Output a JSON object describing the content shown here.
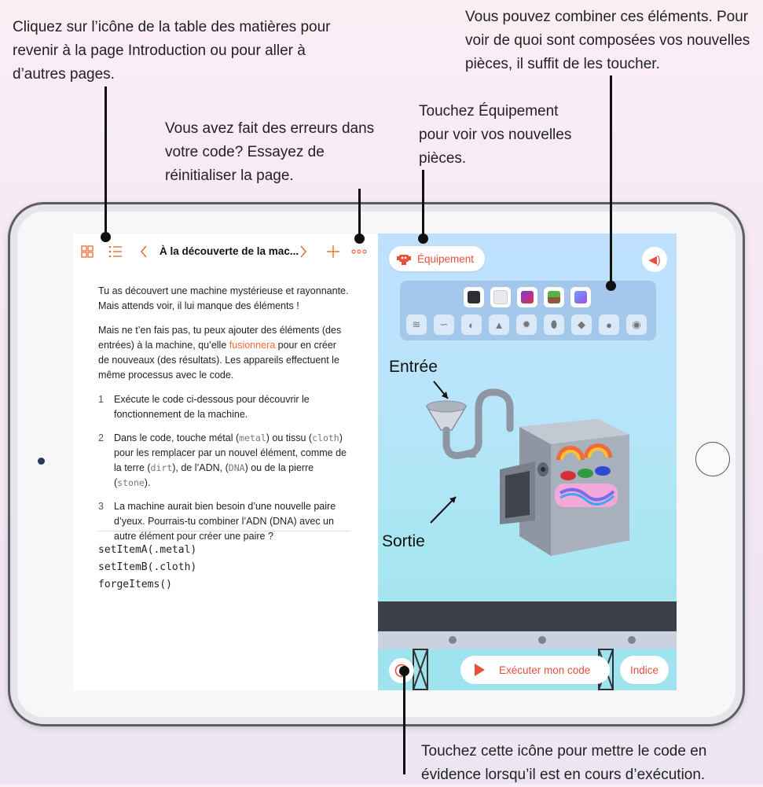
{
  "callouts": {
    "toc": "Cliquez sur l’icône de la table des matières pour revenir à la page Introduction ou pour aller à d’autres pages.",
    "combine": "Vous pouvez combiner ces éléments. Pour voir de quoi sont composées vos nouvelles pièces, il suffit de les toucher.",
    "equipment": "Touchez Équipement pour voir vos nouvelles pièces.",
    "reset": "Vous avez fait des erreurs dans votre code? Essayez de réinitialiser la page.",
    "highlight": "Touchez cette icône pour mettre le code en évidence lorsqu’il est en cours d’exécution."
  },
  "toolbar": {
    "page_title": "À la découverte de la mac...",
    "grid_icon": "grid-icon",
    "list_icon": "list-icon",
    "back_icon": "chevron-left-icon",
    "forward_icon": "chevron-right-icon",
    "add_icon": "plus-icon",
    "more_icon": "ellipsis-icon"
  },
  "content": {
    "intro": "Tu as découvert une machine mystérieuse et rayonnante. Mais attends voir, il lui manque des éléments !",
    "para2_before": "Mais ne t’en fais pas, tu peux ajouter des éléments (des entrées) à la machine, qu’elle ",
    "para2_link": "fusionnera",
    "para2_after": " pour en créer de nouveaux (des résultats). Les appareils effectuent le même processus avec le code.",
    "step1_num": "1",
    "step1": "Exécute le code ci-dessous pour découvrir le fonctionnement de la machine.",
    "step2_num": "2",
    "step2_a": "Dans le code, touche métal (",
    "step2_metal": "metal",
    "step2_b": ") ou tissu (",
    "step2_cloth": "cloth",
    "step2_c": ") pour les remplacer par un nouvel élément, comme de la terre (",
    "step2_dirt": "dirt",
    "step2_d": "), de l’ADN, (",
    "step2_dna": "DNA",
    "step2_e": ") ou de la pierre (",
    "step2_stone": "stone",
    "step2_f": ").",
    "step3_num": "3",
    "step3": "La machine aurait bien besoin d’une nouvelle paire d’yeux. Pourrais-tu combiner l’ADN (DNA) avec un autre élément pour créer une paire ?"
  },
  "code": [
    "setItemA(.metal)",
    "setItemB(.cloth)",
    "forgeItems()"
  ],
  "live_view": {
    "equipment_label": "Équipement",
    "equipment_icon": "robot-icon",
    "sound_icon": "speaker-icon",
    "input_label": "Entrée",
    "output_label": "Sortie",
    "run_label": "Exécuter mon code",
    "hint_label": "Indice",
    "timer_icon": "speedometer-icon",
    "row1_colors": [
      "#2f2f33",
      "#f2f2f5",
      "#d9334d",
      "#5bb04a",
      "#6a5ee0"
    ],
    "row2_icons": [
      "layers-icon",
      "wave-icon",
      "seed-icon",
      "rock-icon",
      "gear-icon",
      "egg-icon",
      "gem-icon",
      "spores-icon",
      "ball-icon"
    ]
  },
  "colors": {
    "accent": "#f26b3a",
    "accent_red": "#e5503b"
  }
}
